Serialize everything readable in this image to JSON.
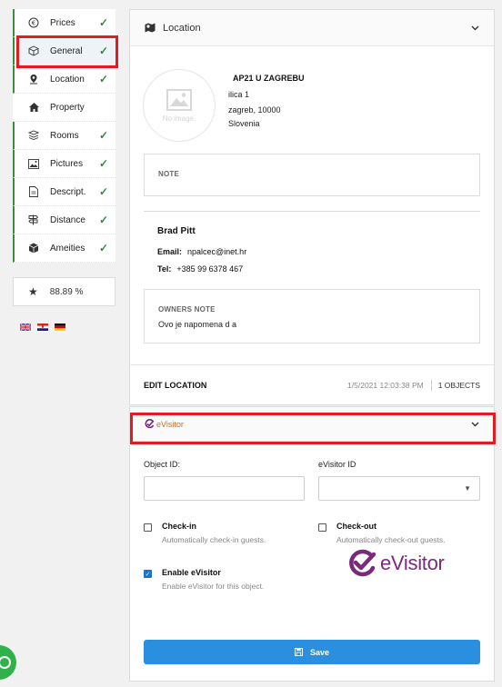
{
  "sidebar": {
    "items": [
      {
        "label": "Prices",
        "icon": "euro-icon",
        "done": true
      },
      {
        "label": "General",
        "icon": "cube-outline-icon",
        "done": true
      },
      {
        "label": "Location",
        "icon": "map-pin-icon",
        "done": true
      },
      {
        "label": "Property",
        "icon": "house-icon",
        "done": false
      },
      {
        "label": "Rooms",
        "icon": "bed-stack-icon",
        "done": true
      },
      {
        "label": "Pictures",
        "icon": "picture-icon",
        "done": true
      },
      {
        "label": "Descript.",
        "icon": "document-icon",
        "done": true
      },
      {
        "label": "Distance",
        "icon": "signpost-icon",
        "done": true
      },
      {
        "label": "Ameities",
        "icon": "box-icon",
        "done": true
      }
    ],
    "score": "88.89 %",
    "flags": [
      "uk-flag-icon",
      "croatia-flag-icon",
      "germany-flag-icon"
    ]
  },
  "location_card": {
    "title": "Location",
    "no_image_text": "No image.",
    "address": {
      "name": "AP21 U ZAGREBU",
      "street": "ilica 1",
      "city": "zagreb, 10000",
      "country": "Slovenia"
    },
    "note_label": "NOTE",
    "owner": {
      "name": "Brad Pitt",
      "email_label": "Email:",
      "email": "npalcec@inet.hr",
      "tel_label": "Tel:",
      "tel": "+385 99 6378 467"
    },
    "owners_note_label": "OWNERS NOTE",
    "owners_note_text": "Ovo je napomena d a",
    "footer": {
      "edit_label": "EDIT LOCATION",
      "timestamp": "1/5/2021 12:03:38 PM",
      "objects": "1 OBJECTS"
    }
  },
  "evisitor_card": {
    "header_logo_text": "eVisitor",
    "object_id_label": "Object ID:",
    "object_id_value": "",
    "evisitor_id_label": "eVisitor ID",
    "evisitor_id_value": "",
    "checkin": {
      "title": "Check-in",
      "desc": "Automatically check-in guests.",
      "checked": false
    },
    "checkout": {
      "title": "Check-out",
      "desc": "Automatically check-out guests.",
      "checked": false
    },
    "enable": {
      "title": "Enable eVisitor",
      "desc": "Enable eVisitor for this object.",
      "checked": true
    },
    "big_logo_text": "eVisitor",
    "save_label": "Save"
  },
  "colors": {
    "done_check": "#2e8b3a",
    "highlight": "#e31c24",
    "save_button": "#2b8fe0",
    "evisitor_purple": "#7a2a7c",
    "evisitor_orange": "#d2691e",
    "chat": "#2fb24a"
  }
}
